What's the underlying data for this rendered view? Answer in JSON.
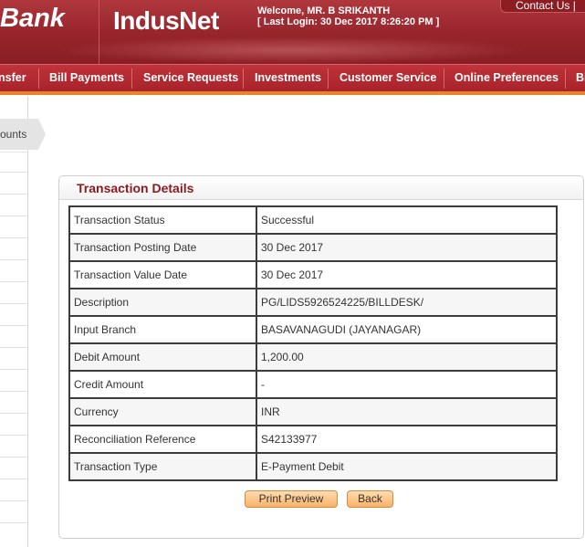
{
  "header": {
    "bank_logo": "Bank",
    "product_logo": "IndusNet",
    "welcome_line": "Welcome, MR. B  SRIKANTH",
    "last_login_line": "[ Last Login: 30 Dec 2017 8:26:20 PM ]",
    "contact_us": "Contact Us  |"
  },
  "nav": {
    "items": [
      "nsfer",
      "Bill Payments",
      "Service Requests",
      "Investments",
      "Customer Service",
      "Online Preferences",
      "Bi"
    ]
  },
  "sidebar": {
    "active_tab": "ounts"
  },
  "panel": {
    "title": "Transaction Details",
    "rows": [
      {
        "label": "Transaction Status",
        "value": "Successful"
      },
      {
        "label": "Transaction Posting Date",
        "value": "30 Dec 2017"
      },
      {
        "label": "Transaction Value Date",
        "value": "30 Dec 2017"
      },
      {
        "label": "Description",
        "value": "PG/LIDS5926524225/BILLDESK/"
      },
      {
        "label": "Input Branch",
        "value": "BASAVANAGUDI (JAYANAGAR)"
      },
      {
        "label": "Debit Amount",
        "value": "1,200.00"
      },
      {
        "label": "Credit Amount",
        "value": "-"
      },
      {
        "label": " Currency",
        "value": "INR"
      },
      {
        "label": "Reconciliation Reference",
        "value": "S42133977"
      },
      {
        "label": "Transaction Type",
        "value": "E-Payment Debit"
      }
    ],
    "print_preview_label": "Print Preview",
    "back_label": "Back"
  },
  "colors": {
    "brand_red": "#97242b",
    "nav_red": "#b22a31",
    "accent_orange": "#e8842e",
    "title_red": "#8b1a1f"
  }
}
